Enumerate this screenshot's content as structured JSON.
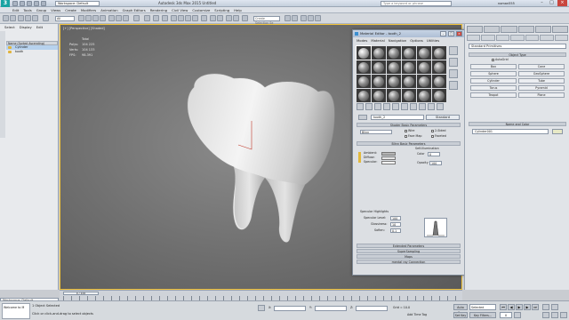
{
  "titlebar": {
    "workspace": "Workspace: Default",
    "app_title": "Autodesk 3ds Max 2015   Untitled",
    "search_placeholder": "Type a keyword or phrase",
    "user": "noman555"
  },
  "menu": [
    "Edit",
    "Tools",
    "Group",
    "Views",
    "Create",
    "Modifiers",
    "Animation",
    "Graph Editors",
    "Rendering",
    "Civil View",
    "Customize",
    "Scripting",
    "Help"
  ],
  "toolbar": {
    "view_dropdown": "All",
    "selection_set": "Create Selection Se"
  },
  "explorer": {
    "menu": [
      "Select",
      "Display",
      "Edit"
    ],
    "header": "Name (Sorted Ascending)",
    "rows": [
      "Cylinder",
      "tooth"
    ]
  },
  "viewport": {
    "label": "[+] [Perspective] [Shaded]",
    "stats_title": "Total",
    "stats": [
      {
        "k": "Polys:",
        "v": "104 225"
      },
      {
        "k": "Verts:",
        "v": "104 133"
      },
      {
        "k": "FPS:",
        "v": "98.391"
      }
    ]
  },
  "material_editor": {
    "title": "Material Editor - tooth_2",
    "menu": [
      "Modes",
      "Material",
      "Navigation",
      "Options",
      "Utilities"
    ],
    "material_name": "tooth_2",
    "material_type": "Standard",
    "rollouts": {
      "shader_basic": "Shader Basic Parameters",
      "blinn_basic": "Blinn Basic Parameters",
      "extended": "Extended Parameters",
      "supersampling": "SuperSampling",
      "maps": "Maps",
      "mental_ray": "mental ray Connection"
    },
    "shader": "Blinn",
    "checks": [
      "Wire",
      "2-Sided",
      "Face Map",
      "Faceted"
    ],
    "self_illum_label": "Self-Illumination",
    "color_label": "Color",
    "color_value": "0",
    "opacity_label": "Opacity",
    "opacity_value": "100",
    "ambient": "Ambient:",
    "diffuse": "Diffuse:",
    "specular": "Specular:",
    "spec_highlights": "Specular Highlights",
    "spec_level": "Specular Level:",
    "spec_level_v": "100",
    "glossiness": "Glossiness:",
    "glossiness_v": "10",
    "soften": "Soften:",
    "soften_v": "0.1"
  },
  "command_panel": {
    "dropdown": "Standard Primitives",
    "object_type": "Object Type",
    "autogrid": "AutoGrid",
    "buttons": [
      "Box",
      "Cone",
      "Sphere",
      "GeoSphere",
      "Cylinder",
      "Tube",
      "Torus",
      "Pyramid",
      "Teapot",
      "Plane"
    ],
    "name_color": "Name and Color",
    "name": "Cylinder001"
  },
  "timeline": {
    "slider": "0 / 100"
  },
  "status": {
    "maxscript": "Welcome to M",
    "line1": "1 Object Selected",
    "line2": "Click or click-and-drag to select objects",
    "x": "X:",
    "y": "Y:",
    "z": "Z:",
    "grid": "Grid = 10.0",
    "add_time_tag": "Add Time Tag",
    "auto_key": "Auto Key",
    "set_key": "Set Key",
    "selected": "Selected",
    "key_filters": "Key Filters...",
    "frame": "0"
  }
}
